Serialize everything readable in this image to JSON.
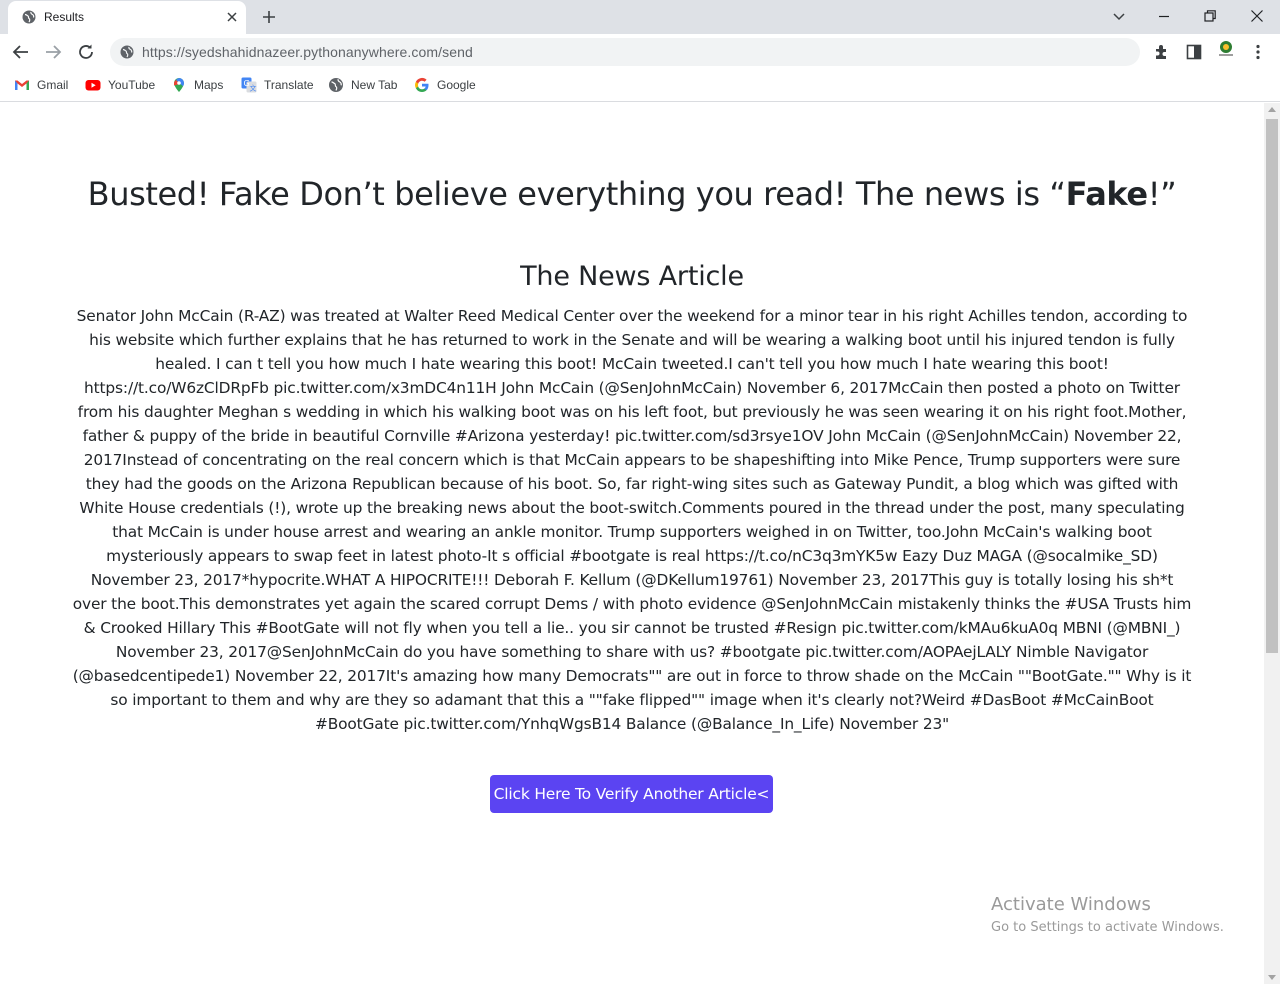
{
  "browser": {
    "tab_title": "Results",
    "url": "https://syedshahidnazeer.pythonanywhere.com/send",
    "bookmarks": [
      {
        "label": "Gmail",
        "icon": "gmail-icon"
      },
      {
        "label": "YouTube",
        "icon": "youtube-icon"
      },
      {
        "label": "Maps",
        "icon": "maps-icon"
      },
      {
        "label": "Translate",
        "icon": "translate-icon"
      },
      {
        "label": "New Tab",
        "icon": "globe-icon"
      },
      {
        "label": "Google",
        "icon": "google-icon"
      }
    ],
    "colors": {
      "tab_strip": "#dee1e6",
      "omnibox": "#f1f3f4"
    }
  },
  "page": {
    "headline_prefix": "Busted! Fake Don’t believe everything you read! The news is “",
    "headline_verdict": "Fake",
    "headline_suffix": "!”",
    "article_title": "The News Article",
    "article_text": "Senator John McCain (R-AZ) was treated at Walter Reed Medical Center over the weekend for a minor tear in his right Achilles tendon, according to his website which further explains that he has returned to work in the Senate and will be wearing a walking boot until his injured tendon is fully healed. I can t tell you how much I hate wearing this boot! McCain tweeted.I can't tell you how much I hate wearing this boot! https://t.co/W6zClDRpFb pic.twitter.com/x3mDC4n11H John McCain (@SenJohnMcCain) November 6, 2017McCain then posted a photo on Twitter from his daughter Meghan s wedding in which his walking boot was on his left foot, but previously he was seen wearing it on his right foot.Mother, father & puppy of the bride in beautiful Cornville #Arizona yesterday! pic.twitter.com/sd3rsye1OV John McCain (@SenJohnMcCain) November 22, 2017Instead of concentrating on the real concern which is that McCain appears to be shapeshifting into Mike Pence, Trump supporters were sure they had the goods on the Arizona Republican because of his boot. So, far right-wing sites such as Gateway Pundit, a blog which was gifted with White House credentials (!), wrote up the breaking news about the boot-switch.Comments poured in the thread under the post, many speculating that McCain is under house arrest and wearing an ankle monitor. Trump supporters weighed in on Twitter, too.John McCain's walking boot mysteriously appears to swap feet in latest photo-It s official #bootgate is real https://t.co/nC3q3mYK5w Eazy Duz MAGA (@socalmike_SD) November 23, 2017*hypocrite.WHAT A HIPOCRITE!!! Deborah F. Kellum (@DKellum19761) November 23, 2017This guy is totally losing his sh*t over the boot.This demonstrates yet again the scared corrupt Dems / with photo evidence @SenJohnMcCain mistakenly thinks the #USA Trusts him & Crooked Hillary This #BootGate will not fly when you tell a lie.. you sir cannot be trusted #Resign pic.twitter.com/kMAu6kuA0q MBNI (@MBNI_) November 23, 2017@SenJohnMcCain do you have something to share with us? #bootgate pic.twitter.com/AOPAejLALY Nimble Navigator (@basedcentipede1) November 22, 2017It's amazing how many Democrats\"\" are out in force to throw shade on the McCain \"\"BootGate.\"\" Why is it so important to them and why are they so adamant that this a \"\"fake flipped\"\" image when it's clearly not?Weird #DasBoot #McCainBoot #BootGate pic.twitter.com/YnhqWgsB14 Balance (@Balance_In_Life) November 23\"",
    "verify_button_label": "Click Here To Verify Another Article<",
    "colors": {
      "button": "#5b44f2",
      "text": "#212529"
    }
  },
  "os_watermark": {
    "title": "Activate Windows",
    "subtitle": "Go to Settings to activate Windows."
  }
}
